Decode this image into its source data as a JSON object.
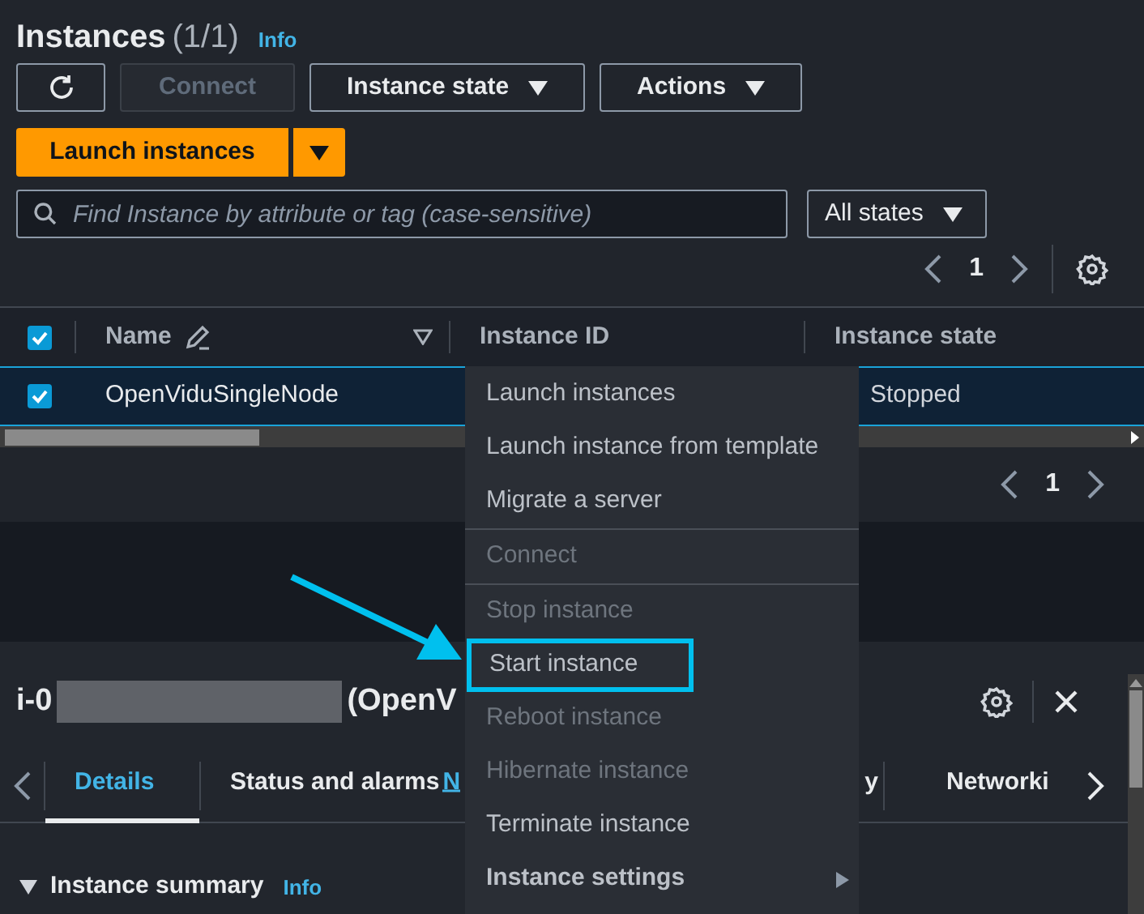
{
  "header": {
    "title": "Instances",
    "count": "(1/1)",
    "info": "Info"
  },
  "toolbar": [
    {
      "label": "Connect",
      "kind": "button",
      "disabled": true
    },
    {
      "label": "Instance state",
      "kind": "dropdown",
      "disabled": false
    },
    {
      "label": "Actions",
      "kind": "dropdown",
      "disabled": false
    }
  ],
  "launch": {
    "label": "Launch instances"
  },
  "search": {
    "placeholder": "Find Instance by attribute or tag (case-sensitive)"
  },
  "state_filter": {
    "value": "All states"
  },
  "pagination_top": {
    "page": "1"
  },
  "table": {
    "all_checked": true,
    "columns": [
      {
        "label": "Name"
      },
      {
        "label": "Instance ID"
      },
      {
        "label": "Instance state"
      }
    ],
    "rows": [
      {
        "checked": true,
        "selected": true,
        "name": "OpenViduSingleNode",
        "state": "Stopped"
      }
    ]
  },
  "pagination_bottom": {
    "page": "1"
  },
  "details": {
    "title_prefix": "i-0",
    "title_suffix": "(OpenV",
    "tabs": [
      {
        "label": "Details",
        "selected": true
      },
      {
        "label": "Status and alarms",
        "badge": "N",
        "selected": false
      },
      {
        "label": "y",
        "selected": false
      },
      {
        "label": "Networki",
        "selected": false
      }
    ],
    "section": {
      "title": "Instance summary",
      "info": "Info",
      "expanded": true
    }
  },
  "context_menu": {
    "groups": [
      [
        {
          "label": "Launch instances",
          "kind": "item",
          "disabled": false,
          "highlighted": false
        },
        {
          "label": "Launch instance from template",
          "kind": "item",
          "disabled": false,
          "highlighted": false
        },
        {
          "label": "Migrate a server",
          "kind": "item",
          "disabled": false,
          "highlighted": false
        }
      ],
      [
        {
          "label": "Connect",
          "kind": "item",
          "disabled": true,
          "highlighted": false
        }
      ],
      [
        {
          "label": "Stop instance",
          "kind": "item",
          "disabled": true,
          "highlighted": false
        },
        {
          "label": "Start instance",
          "kind": "item",
          "disabled": false,
          "highlighted": true
        },
        {
          "label": "Reboot instance",
          "kind": "item",
          "disabled": true,
          "highlighted": false
        },
        {
          "label": "Hibernate instance",
          "kind": "item",
          "disabled": true,
          "highlighted": false
        },
        {
          "label": "Terminate instance",
          "kind": "item",
          "disabled": false,
          "highlighted": false
        },
        {
          "label": "Instance settings",
          "kind": "submenu",
          "disabled": false,
          "highlighted": false
        }
      ]
    ]
  }
}
